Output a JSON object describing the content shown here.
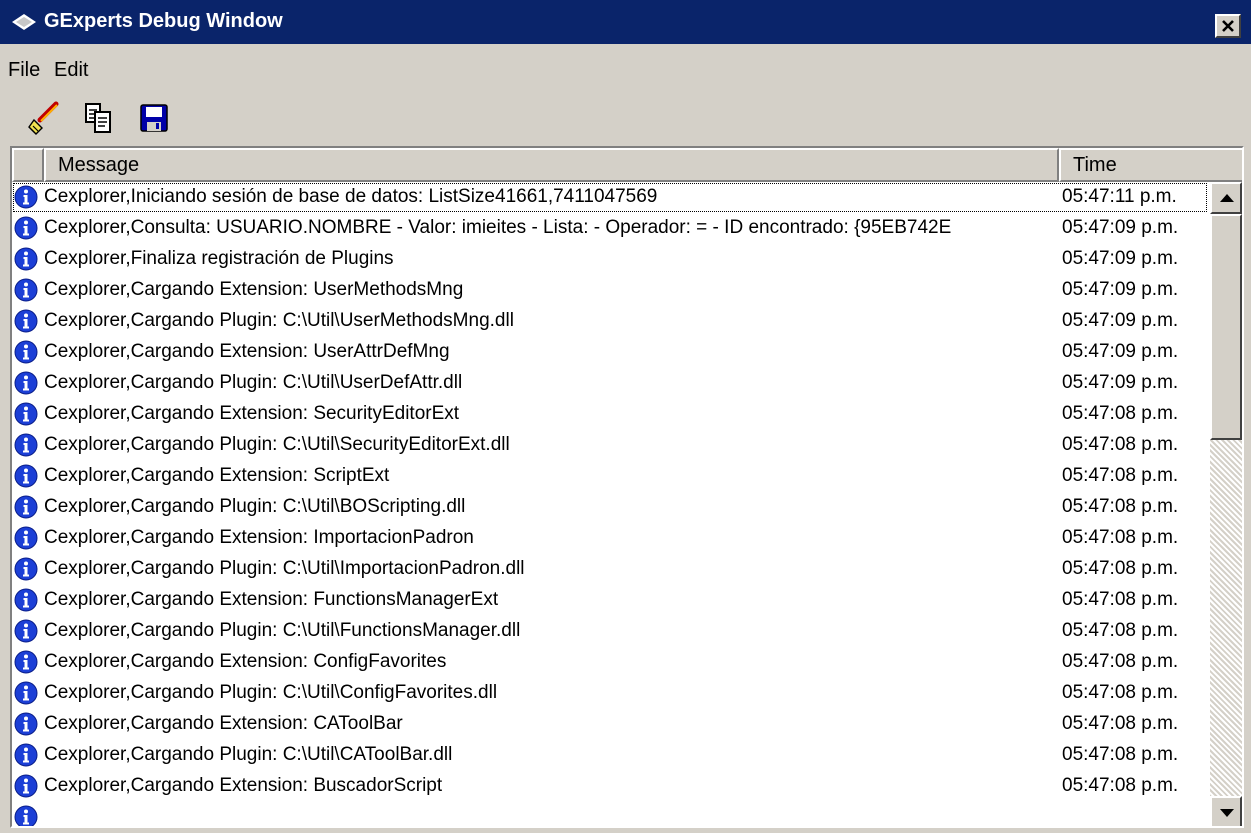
{
  "window": {
    "title": "GExperts Debug Window",
    "close_glyph": "✕"
  },
  "menu": {
    "items": [
      "File",
      "Edit"
    ]
  },
  "toolbar": {
    "buttons": [
      {
        "icon": "clear-icon"
      },
      {
        "icon": "copy-icon"
      },
      {
        "icon": "save-icon"
      }
    ]
  },
  "list": {
    "columns": {
      "message": "Message",
      "time": "Time"
    },
    "row_icon": "info-icon",
    "rows": [
      {
        "message": "Cexplorer,Iniciando sesión de base de datos: ListSize41661,7411047569",
        "time": "05:47:11 p.m."
      },
      {
        "message": "Cexplorer,Consulta: USUARIO.NOMBRE - Valor: imieites - Lista:  - Operador: = - ID encontrado: {95EB742E",
        "time": "05:47:09 p.m."
      },
      {
        "message": "Cexplorer,Finaliza registración de Plugins",
        "time": "05:47:09 p.m."
      },
      {
        "message": "Cexplorer,Cargando Extension: UserMethodsMng",
        "time": "05:47:09 p.m."
      },
      {
        "message": "Cexplorer,Cargando Plugin: C:\\Util\\UserMethodsMng.dll",
        "time": "05:47:09 p.m."
      },
      {
        "message": "Cexplorer,Cargando Extension: UserAttrDefMng",
        "time": "05:47:09 p.m."
      },
      {
        "message": "Cexplorer,Cargando Plugin: C:\\Util\\UserDefAttr.dll",
        "time": "05:47:09 p.m."
      },
      {
        "message": "Cexplorer,Cargando Extension: SecurityEditorExt",
        "time": "05:47:08 p.m."
      },
      {
        "message": "Cexplorer,Cargando Plugin: C:\\Util\\SecurityEditorExt.dll",
        "time": "05:47:08 p.m."
      },
      {
        "message": "Cexplorer,Cargando Extension: ScriptExt",
        "time": "05:47:08 p.m."
      },
      {
        "message": "Cexplorer,Cargando Plugin: C:\\Util\\BOScripting.dll",
        "time": "05:47:08 p.m."
      },
      {
        "message": "Cexplorer,Cargando Extension: ImportacionPadron",
        "time": "05:47:08 p.m."
      },
      {
        "message": "Cexplorer,Cargando Plugin: C:\\Util\\ImportacionPadron.dll",
        "time": "05:47:08 p.m."
      },
      {
        "message": "Cexplorer,Cargando Extension: FunctionsManagerExt",
        "time": "05:47:08 p.m."
      },
      {
        "message": "Cexplorer,Cargando Plugin: C:\\Util\\FunctionsManager.dll",
        "time": "05:47:08 p.m."
      },
      {
        "message": "Cexplorer,Cargando Extension: ConfigFavorites",
        "time": "05:47:08 p.m."
      },
      {
        "message": "Cexplorer,Cargando Plugin: C:\\Util\\ConfigFavorites.dll",
        "time": "05:47:08 p.m."
      },
      {
        "message": "Cexplorer,Cargando Extension: CAToolBar",
        "time": "05:47:08 p.m."
      },
      {
        "message": "Cexplorer,Cargando Plugin: C:\\Util\\CAToolBar.dll",
        "time": "05:47:08 p.m."
      },
      {
        "message": "Cexplorer,Cargando Extension: BuscadorScript",
        "time": "05:47:08 p.m."
      },
      {
        "message": "",
        "time": ""
      }
    ]
  },
  "colors": {
    "titlebar": "#0a246a",
    "face": "#d4d0c8",
    "info_icon": "#1c3fd6"
  }
}
